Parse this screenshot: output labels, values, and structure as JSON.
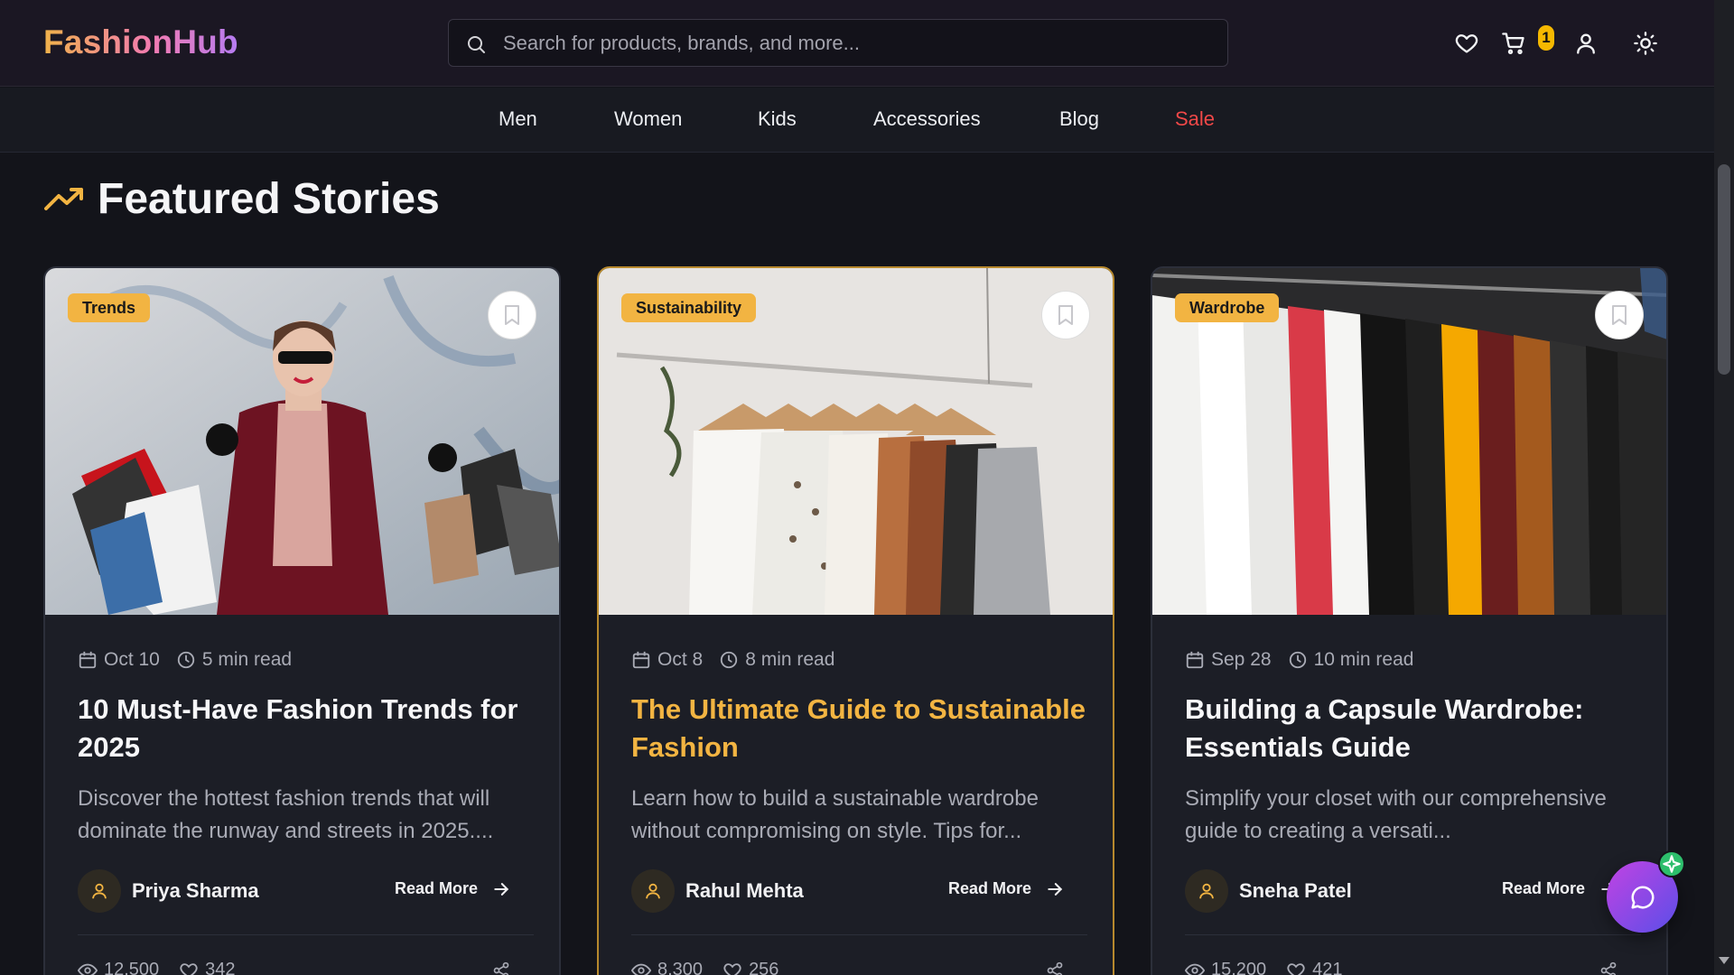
{
  "header": {
    "logo": "FashionHub",
    "search_placeholder": "Search for products, brands, and more...",
    "cart_count": "1",
    "icons": [
      "search-icon",
      "heart-icon",
      "cart-icon",
      "user-icon",
      "sun-icon"
    ]
  },
  "nav": {
    "items": [
      {
        "label": "Men"
      },
      {
        "label": "Women"
      },
      {
        "label": "Kids"
      },
      {
        "label": "Accessories"
      },
      {
        "label": "Blog"
      },
      {
        "label": "Sale"
      }
    ]
  },
  "section": {
    "title": "Featured Stories"
  },
  "cards": [
    {
      "tag": "Trends",
      "date": "Oct 10",
      "read_time": "5 min read",
      "title": "10 Must-Have Fashion Trends for 2025",
      "excerpt": "Discover the hottest fashion trends that will dominate the runway and streets in 2025....",
      "author": "Priya Sharma",
      "read_more": "Read More",
      "views": "12,500",
      "likes": "342"
    },
    {
      "tag": "Sustainability",
      "date": "Oct 8",
      "read_time": "8 min read",
      "title": "The Ultimate Guide to Sustainable Fashion",
      "excerpt": "Learn how to build a sustainable wardrobe without compromising on style. Tips for...",
      "author": "Rahul Mehta",
      "read_more": "Read More",
      "views": "8,300",
      "likes": "256"
    },
    {
      "tag": "Wardrobe",
      "date": "Sep 28",
      "read_time": "10 min read",
      "title": "Building a Capsule Wardrobe: Essentials Guide",
      "excerpt": "Simplify your closet with our comprehensive guide to creating a versati...",
      "author": "Sneha Patel",
      "read_more": "Read More",
      "views": "15,200",
      "likes": "421"
    }
  ],
  "colors": {
    "accent": "#f2b442",
    "sale": "#f04848",
    "background": "#13141a",
    "card": "#1c1e26"
  }
}
